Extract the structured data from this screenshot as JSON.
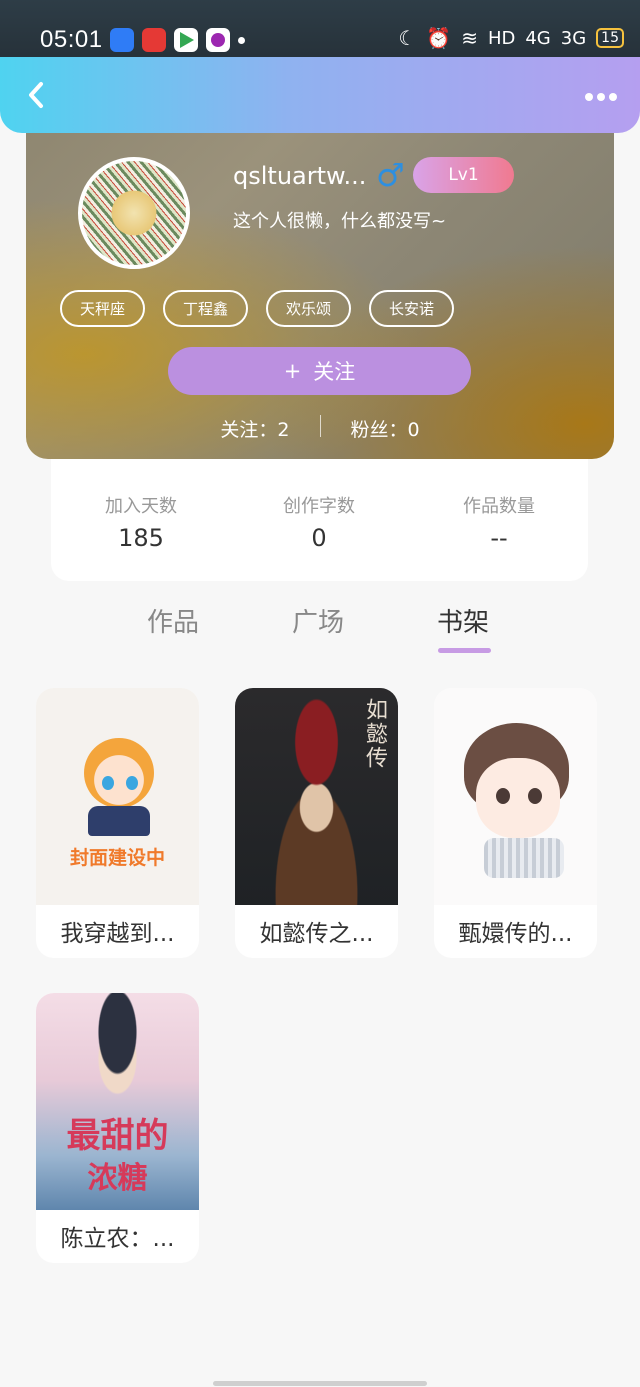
{
  "status_bar": {
    "time": "05:01",
    "network": "HD",
    "signal_1": "4G",
    "signal_2": "3G",
    "battery": "15"
  },
  "header": {
    "back_icon": "chevron-left-icon",
    "more_icon": "more-horizontal-icon"
  },
  "profile": {
    "username": "qsltuartw...",
    "gender_symbol": "♂",
    "level": "Lv1",
    "bio": "这个人很懒，什么都没写~",
    "tags": [
      "天秤座",
      "丁程鑫",
      "欢乐颂",
      "长安诺"
    ],
    "follow_button": {
      "plus": "+",
      "label": "关注"
    },
    "following": "关注：2",
    "followers": "粉丝：0"
  },
  "info": {
    "join_days_label": "加入天数",
    "join_days_value": "185",
    "words_label": "创作字数",
    "words_value": "0",
    "works_label": "作品数量",
    "works_value": "--"
  },
  "tabs": {
    "works": "作品",
    "square": "广场",
    "bookshelf": "书架",
    "active": "书架"
  },
  "books": [
    {
      "title": "我穿越到...",
      "cover_text": "封面建设中"
    },
    {
      "title": "如懿传之...",
      "cover_text": "如懿传"
    },
    {
      "title": "甄嬛传的..."
    },
    {
      "title": "陈立农：...",
      "cover_text_1": "最甜的",
      "cover_text_2": "浓糖"
    }
  ],
  "colors": {
    "header_gradient_start": "#4fd3f0",
    "header_gradient_end": "#b59ff0",
    "follow_button": "#bb90e0",
    "tab_underline": "#c79be4",
    "gender_blue": "#2d8fe0"
  }
}
